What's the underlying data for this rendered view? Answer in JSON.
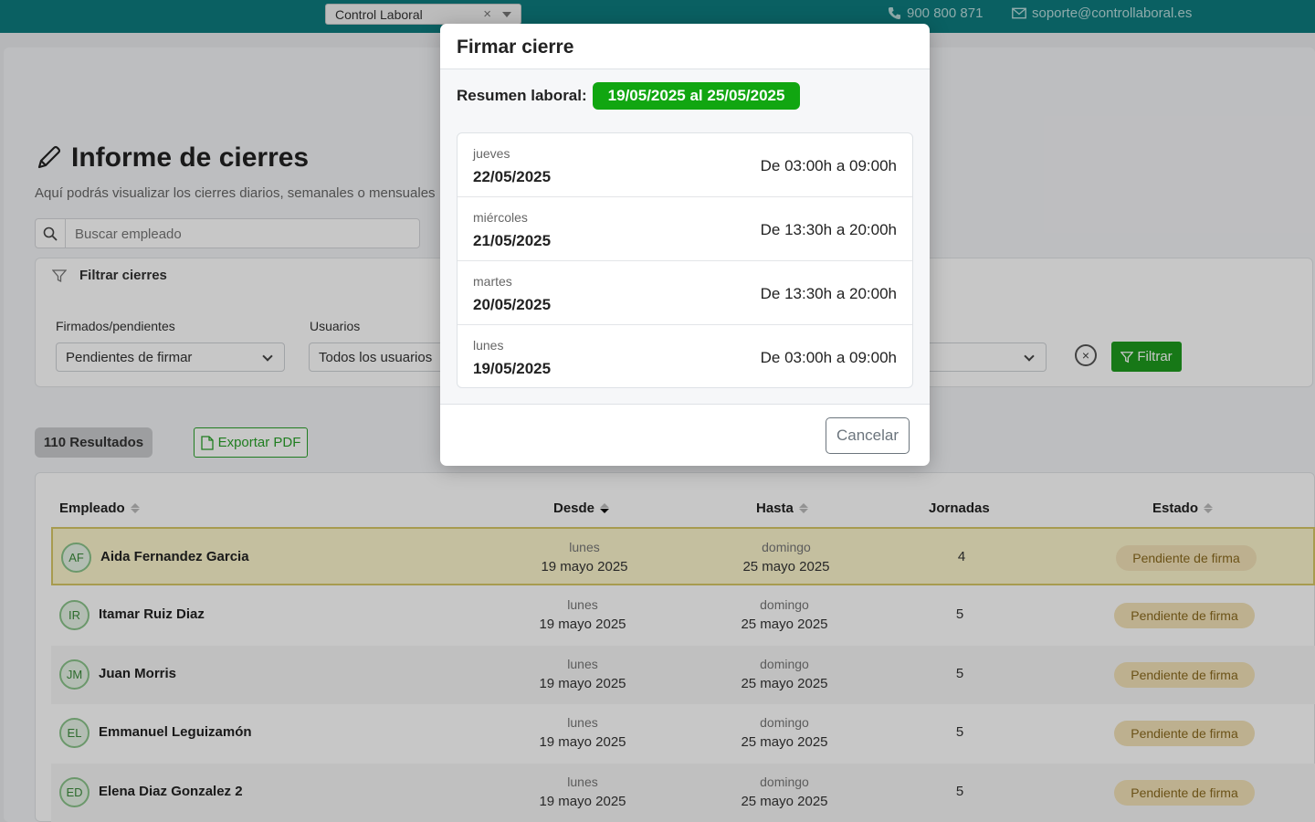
{
  "topbar": {
    "tenant": "Control Laboral",
    "phone": "900 800 871",
    "email": "soporte@controllaboral.es"
  },
  "page": {
    "title": "Informe de cierres",
    "subtitle": "Aquí podrás visualizar los cierres diarios, semanales o mensuales",
    "search_placeholder": "Buscar empleado",
    "filter_title": "Filtrar cierres",
    "filters": {
      "signed_label": "Firmados/pendientes",
      "signed_value": "Pendientes de firmar",
      "users_label": "Usuarios",
      "users_value": "Todos los usuarios",
      "filter_button": "Filtrar"
    },
    "results": "110 Resultados",
    "export_button": "Exportar PDF"
  },
  "table": {
    "headers": {
      "employee": "Empleado",
      "from": "Desde",
      "to": "Hasta",
      "days": "Jornadas",
      "status": "Estado"
    },
    "rows": [
      {
        "initials": "AF",
        "name": "Aida Fernandez Garcia",
        "from_day": "lunes",
        "from_date": "19 mayo 2025",
        "to_day": "domingo",
        "to_date": "25 mayo 2025",
        "days": "4",
        "status": "Pendiente de firma"
      },
      {
        "initials": "IR",
        "name": "Itamar Ruiz Diaz",
        "from_day": "lunes",
        "from_date": "19 mayo 2025",
        "to_day": "domingo",
        "to_date": "25 mayo 2025",
        "days": "5",
        "status": "Pendiente de firma"
      },
      {
        "initials": "JM",
        "name": "Juan Morris",
        "from_day": "lunes",
        "from_date": "19 mayo 2025",
        "to_day": "domingo",
        "to_date": "25 mayo 2025",
        "days": "5",
        "status": "Pendiente de firma"
      },
      {
        "initials": "EL",
        "name": "Emmanuel Leguizamón",
        "from_day": "lunes",
        "from_date": "19 mayo 2025",
        "to_day": "domingo",
        "to_date": "25 mayo 2025",
        "days": "5",
        "status": "Pendiente de firma"
      },
      {
        "initials": "ED",
        "name": "Elena Diaz Gonzalez 2",
        "from_day": "lunes",
        "from_date": "19 mayo 2025",
        "to_day": "domingo",
        "to_date": "25 mayo 2025",
        "days": "5",
        "status": "Pendiente de firma"
      }
    ]
  },
  "modal": {
    "title": "Firmar cierre",
    "summary_label": "Resumen laboral:",
    "summary_range": "19/05/2025 al 25/05/2025",
    "days": [
      {
        "weekday": "jueves",
        "date": "22/05/2025",
        "hours": "De 03:00h a 09:00h"
      },
      {
        "weekday": "miércoles",
        "date": "21/05/2025",
        "hours": "De 13:30h a 20:00h"
      },
      {
        "weekday": "martes",
        "date": "20/05/2025",
        "hours": "De 13:30h a 20:00h"
      },
      {
        "weekday": "lunes",
        "date": "19/05/2025",
        "hours": "De 03:00h a 09:00h"
      }
    ],
    "cancel": "Cancelar"
  },
  "colors": {
    "topbar": "#0d7b7e",
    "accent_green": "#11a611",
    "pending_badge": "#f2e2b8"
  }
}
